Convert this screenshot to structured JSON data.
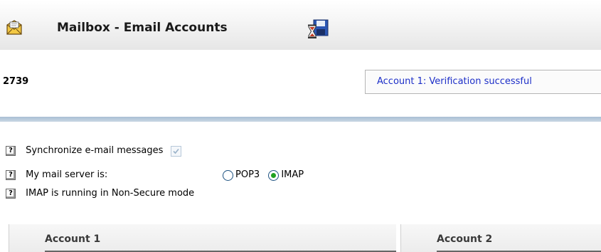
{
  "header": {
    "icon": "mailbox-icon",
    "title": "Mailbox - Email Accounts",
    "save_icon": "save-floppy-hourglass-icon"
  },
  "account_number": "2739",
  "status_message": "Account 1: Verification successful",
  "settings": {
    "sync_label": "Synchronize e-mail messages",
    "sync_checked": true,
    "server_label": "My mail server is:",
    "server_options": [
      "POP3",
      "IMAP"
    ],
    "server_selected": "IMAP",
    "secure_note": "IMAP is running in Non-Secure mode",
    "help_glyph": "?"
  },
  "accounts": {
    "tab1": "Account 1",
    "tab2": "Account 2"
  },
  "colors": {
    "status_text": "#1d2fc8",
    "divider": "#a9bfd4",
    "radio_dot": "#21a121"
  }
}
